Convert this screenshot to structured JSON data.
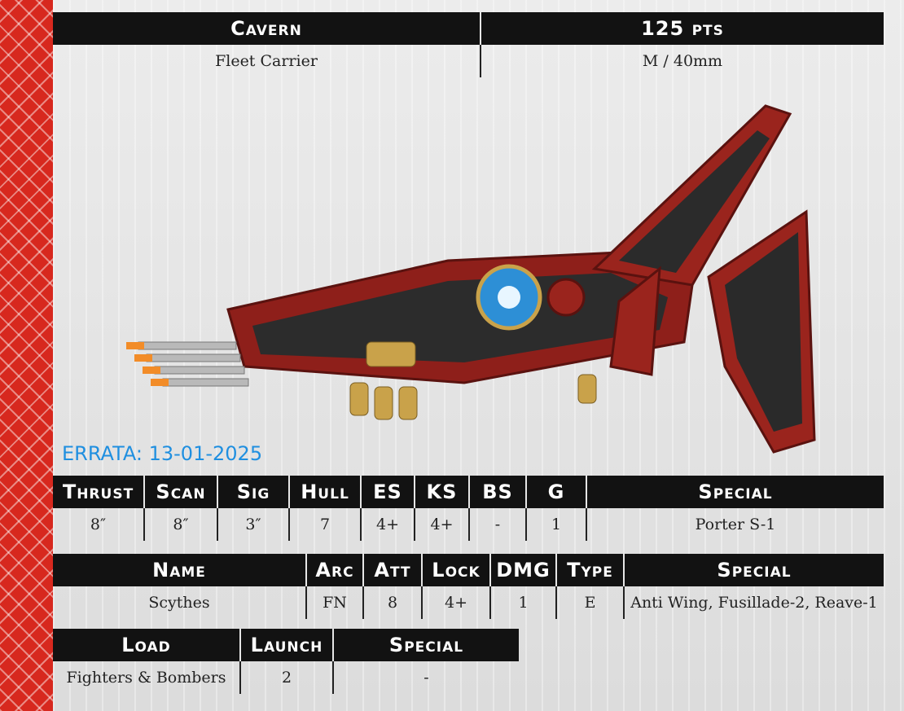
{
  "colors": {
    "stripe": "#d7281e",
    "header_bg": "#121212",
    "errata": "#1f8fe0"
  },
  "header": {
    "name": "Cavern",
    "points": "125 pts",
    "type": "Fleet Carrier",
    "base": "M / 40mm"
  },
  "image": {
    "icon": "spaceship-miniature"
  },
  "errata": "ERRATA: 13-01-2025",
  "stats": {
    "headers": [
      "Thrust",
      "Scan",
      "Sig",
      "Hull",
      "ES",
      "KS",
      "BS",
      "G",
      "Special"
    ],
    "values": [
      "8″",
      "8″",
      "3″",
      "7",
      "4+",
      "4+",
      "-",
      "1",
      "Porter S-1"
    ]
  },
  "weapons": {
    "headers": [
      "Name",
      "Arc",
      "Att",
      "Lock",
      "DMG",
      "Type",
      "Special"
    ],
    "rows": [
      [
        "Scythes",
        "FN",
        "8",
        "4+",
        "1",
        "E",
        "Anti Wing, Fusillade-2, Reave-1"
      ]
    ]
  },
  "launch": {
    "headers": [
      "Load",
      "Launch",
      "Special"
    ],
    "values": [
      "Fighters & Bombers",
      "2",
      "-"
    ]
  }
}
